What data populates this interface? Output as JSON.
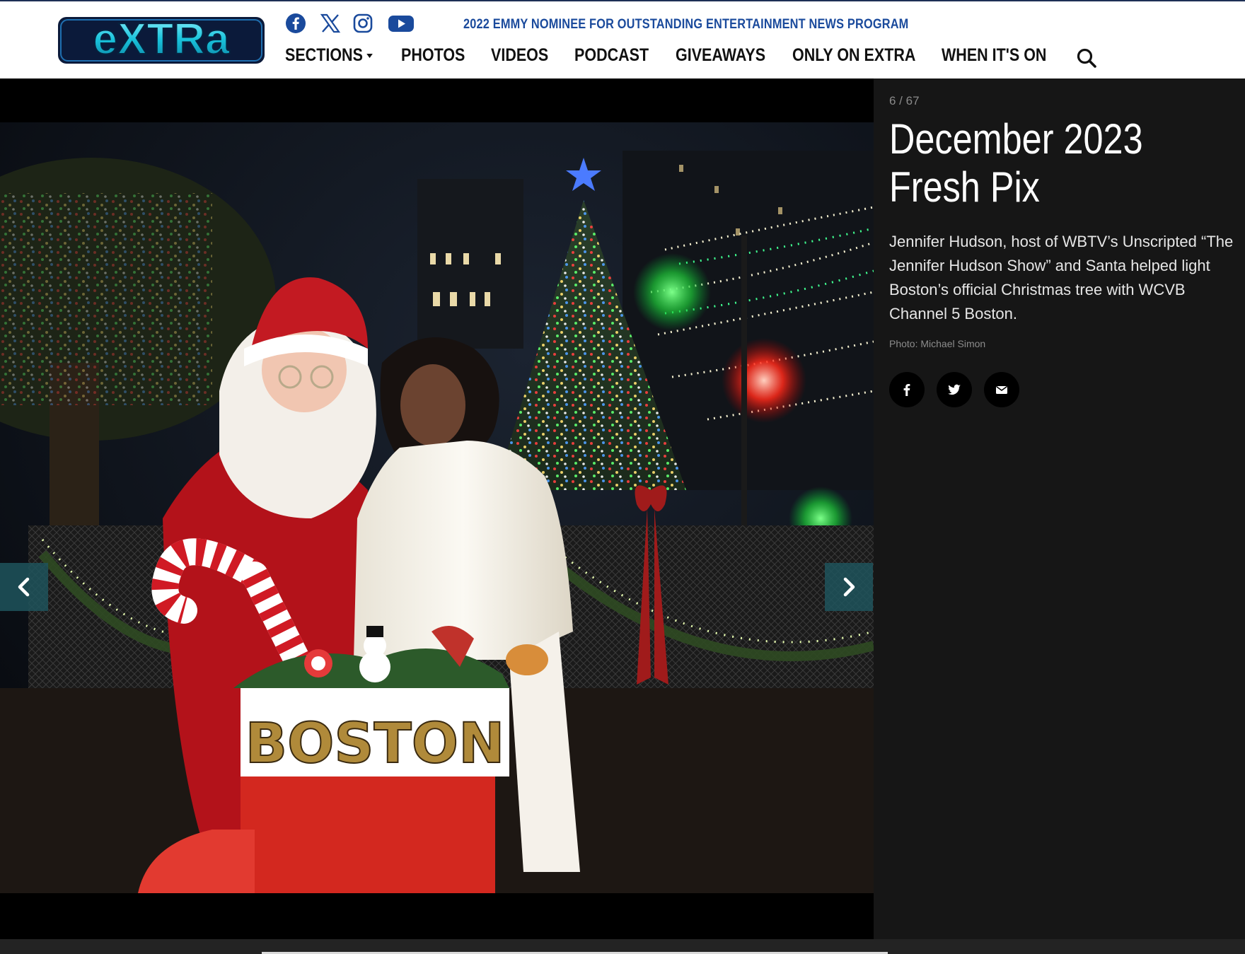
{
  "header": {
    "logo_text": "eXTRa",
    "emmy_banner": "2022 EMMY NOMINEE FOR OUTSTANDING ENTERTAINMENT NEWS PROGRAM",
    "social_icons": [
      "facebook-icon",
      "x-icon",
      "instagram-icon",
      "youtube-icon"
    ],
    "nav": [
      {
        "label": "SECTIONS",
        "has_dropdown": true
      },
      {
        "label": "PHOTOS"
      },
      {
        "label": "VIDEOS"
      },
      {
        "label": "PODCAST"
      },
      {
        "label": "GIVEAWAYS"
      },
      {
        "label": "ONLY ON EXTRA"
      },
      {
        "label": "WHEN IT'S ON"
      }
    ],
    "search_icon": "search-icon"
  },
  "gallery": {
    "photo_sign_text": "BOSTON",
    "prev_icon": "chevron-left-icon",
    "next_icon": "chevron-right-icon"
  },
  "sidebar": {
    "counter": "6 / 67",
    "title": "December 2023 Fresh Pix",
    "caption": "Jennifer Hudson, host of WBTV’s Unscripted “The Jennifer Hudson Show” and Santa helped light Boston’s official Christmas tree with WCVB Channel 5 Boston.",
    "credit": "Photo: Michael Simon",
    "share_icons": [
      "facebook-icon",
      "twitter-icon",
      "email-icon"
    ]
  },
  "colors": {
    "brand_blue": "#1a4a9c",
    "logo_teal": "#14c6d9",
    "sidebar_bg": "#161616",
    "arrow_bg": "#1e545c"
  }
}
